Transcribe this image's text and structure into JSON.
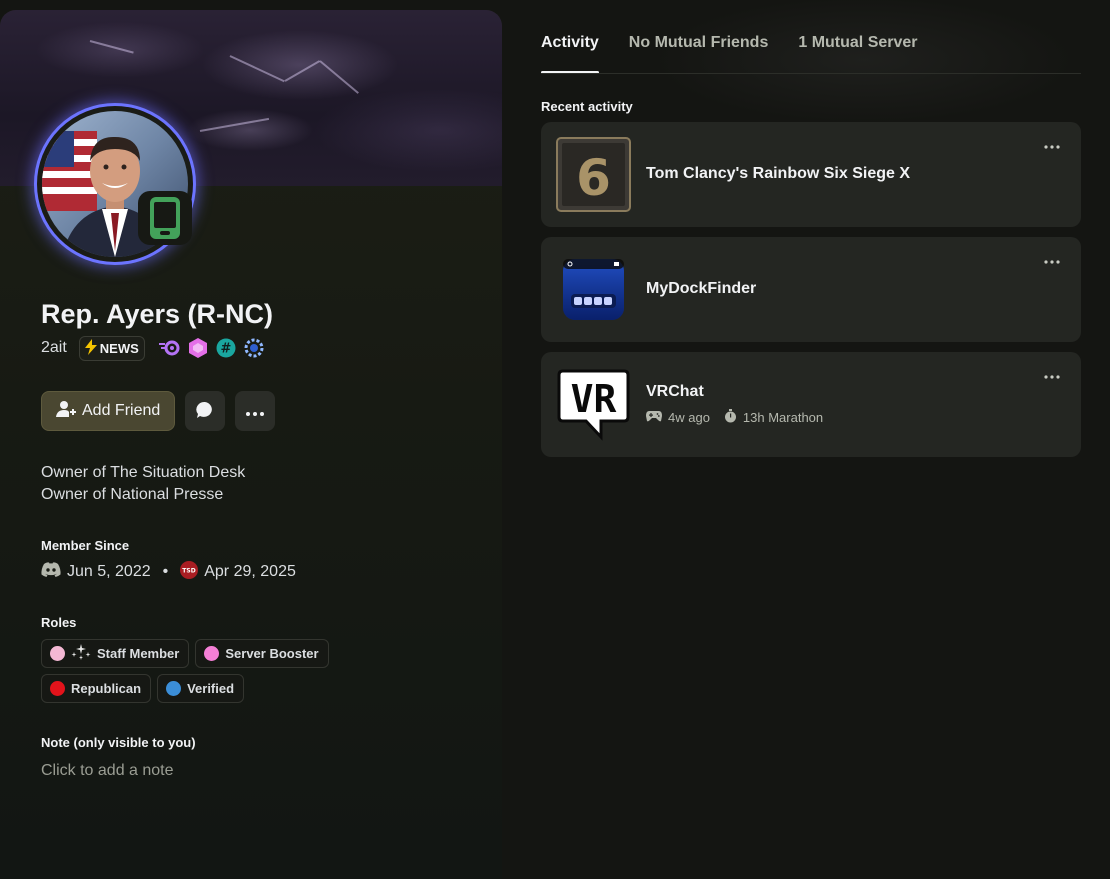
{
  "profile": {
    "display_name": "Rep. Ayers (R-NC)",
    "username": "2ait",
    "guild_tag": "NEWS",
    "status": "mobile-online",
    "badges": [
      "nitro-icon",
      "boost-hex-icon",
      "hashtag-icon",
      "laurel-icon"
    ]
  },
  "actions": {
    "add_friend_label": "Add Friend"
  },
  "bio": {
    "line1": "Owner of The Situation Desk",
    "line2": "Owner of National Presse"
  },
  "member_since": {
    "heading": "Member Since",
    "discord_date": "Jun 5, 2022",
    "separator": "•",
    "server_icon_label": "TSD",
    "server_date": "Apr 29, 2025"
  },
  "roles": {
    "heading": "Roles",
    "items": [
      {
        "name": "Staff Member",
        "color": "#f4b8d4"
      },
      {
        "name": "Server Booster",
        "color": "#f47fd6"
      },
      {
        "name": "Republican",
        "color": "#e3131b"
      },
      {
        "name": "Verified",
        "color": "#3b8ed8"
      }
    ]
  },
  "note": {
    "heading": "Note (only visible to you)",
    "placeholder": "Click to add a note"
  },
  "tabs": [
    {
      "label": "Activity"
    },
    {
      "label": "No Mutual Friends"
    },
    {
      "label": "1 Mutual Server"
    }
  ],
  "activity": {
    "heading": "Recent activity",
    "items": [
      {
        "title": "Tom Clancy's Rainbow Six Siege X",
        "thumb_text": "6"
      },
      {
        "title": "MyDockFinder"
      },
      {
        "title": "VRChat",
        "thumb_text": "VR",
        "last_played": "4w ago",
        "marathon": "13h Marathon"
      }
    ]
  },
  "colors": {
    "accent_ring": "#6c74ff",
    "status_green": "#43a25a",
    "add_friend_bg": "#4a4731"
  }
}
